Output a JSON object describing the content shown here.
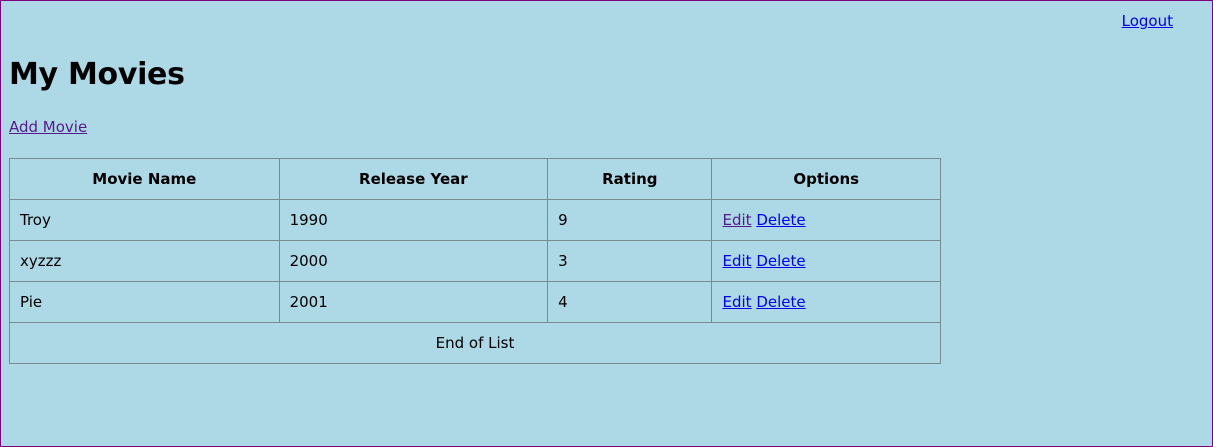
{
  "header": {
    "logout_label": "Logout"
  },
  "page": {
    "title": "My Movies",
    "add_movie_label": "Add Movie"
  },
  "table": {
    "columns": [
      "Movie Name",
      "Release Year",
      "Rating",
      "Options"
    ],
    "rows": [
      {
        "name": "Troy",
        "year": "1990",
        "rating": "9",
        "edit_label": "Edit",
        "delete_label": "Delete"
      },
      {
        "name": "xyzzz",
        "year": "2000",
        "rating": "3",
        "edit_label": "Edit",
        "delete_label": "Delete"
      },
      {
        "name": "Pie",
        "year": "2001",
        "rating": "4",
        "edit_label": "Edit",
        "delete_label": "Delete"
      }
    ],
    "footer": "End of List"
  },
  "colors": {
    "background": "#add8e6",
    "link": "#0000ee",
    "visited_link": "#551a8b",
    "page_border": "#800080"
  }
}
